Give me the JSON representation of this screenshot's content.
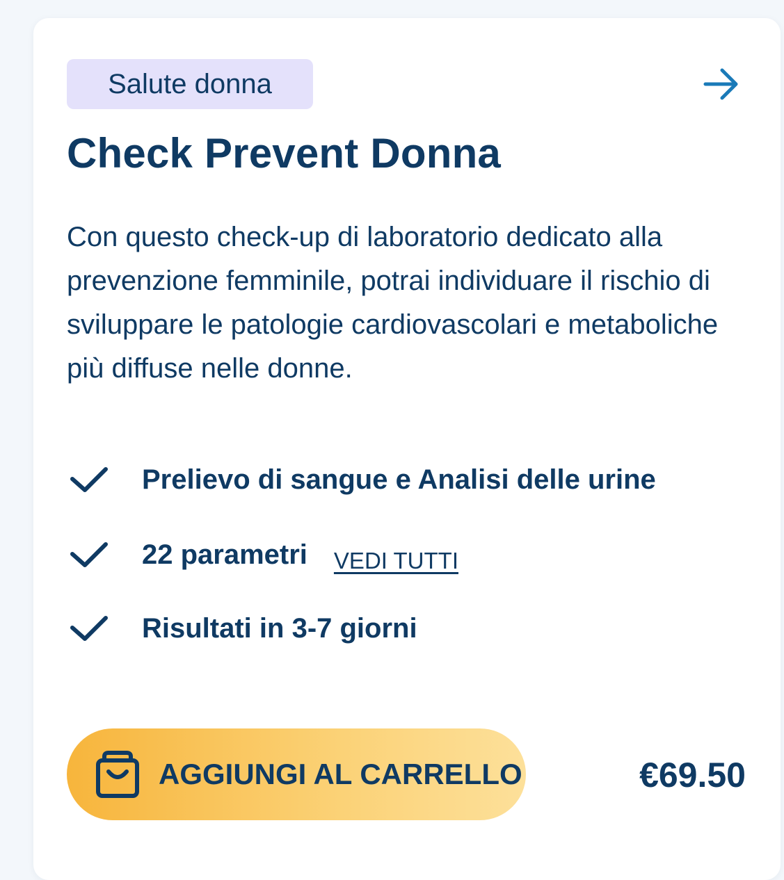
{
  "card": {
    "tag": "Salute donna",
    "arrow_icon": "arrow-right-icon",
    "title": "Check Prevent Donna",
    "description": "Con questo check-up di laboratorio dedicato alla prevenzione femminile, potrai individuare il rischio di sviluppare le patologie cardiovascolari e metaboliche più diffuse nelle donne.",
    "features": [
      {
        "icon": "check-icon",
        "text": "Prelievo di sangue e Analisi delle urine"
      },
      {
        "icon": "check-icon",
        "text": "22 parametri",
        "link": "VEDI TUTTI"
      },
      {
        "icon": "check-icon",
        "text": "Risultati in 3-7 giorni"
      }
    ],
    "cart_button": {
      "icon": "shopping-bag-icon",
      "label": "AGGIUNGI AL CARRELLO"
    },
    "price": "€69.50"
  },
  "colors": {
    "text": "#0f3a63",
    "tag_background": "#e4e1fb",
    "arrow": "#1a7ab8",
    "button_gradient_start": "#f7b53c",
    "button_gradient_end": "#fde09a",
    "page_background": "#f3f7fb"
  }
}
